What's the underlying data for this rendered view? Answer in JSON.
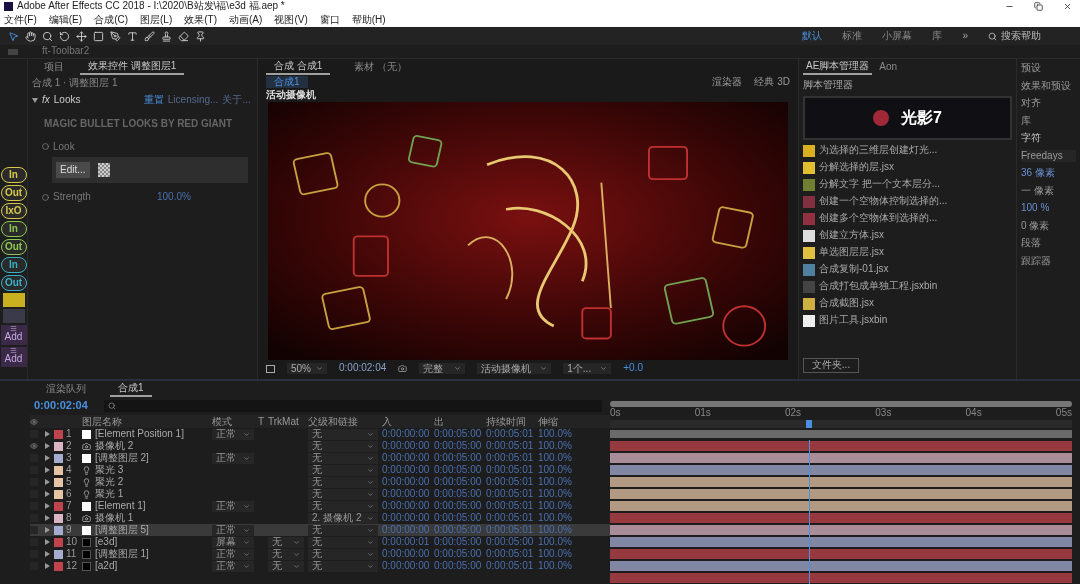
{
  "window": {
    "title": "Adobe After Effects CC 2018 - I:\\2020\\B站发\\福\\e3d 福.aep *"
  },
  "menu": [
    "文件(F)",
    "编辑(E)",
    "合成(C)",
    "图层(L)",
    "效果(T)",
    "动画(A)",
    "视图(V)",
    "窗口",
    "帮助(H)"
  ],
  "workspaces": [
    {
      "label": "默认",
      "selected": true
    },
    {
      "label": "标准",
      "selected": false
    },
    {
      "label": "小屏幕",
      "selected": false
    },
    {
      "label": "库",
      "selected": false
    }
  ],
  "workspace_more": "»",
  "search_help": {
    "placeholder": "搜索帮助"
  },
  "toolbar_panel": {
    "title": "ft-Toolbar2"
  },
  "script_buttons": [
    {
      "label": "In",
      "color": "#d8c84a"
    },
    {
      "label": "Out",
      "color": "#d8c84a"
    },
    {
      "label": "IxO",
      "color": "#d8c84a"
    },
    {
      "label": "In",
      "color": "#8cc850"
    },
    {
      "label": "Out",
      "color": "#8cc850"
    },
    {
      "label": "In",
      "color": "#3ab0c8"
    },
    {
      "label": "Out",
      "color": "#3ab0c8"
    }
  ],
  "add_buttons": [
    "Add",
    "Add"
  ],
  "effect_panel": {
    "tabs": [
      {
        "label": "项目",
        "selected": false
      },
      {
        "label": "效果控件 调整图层1",
        "selected": true
      }
    ],
    "subtitle": "合成 1 · 调整图层 1",
    "effect": {
      "badge": "fx",
      "name": "Looks",
      "expanded": true,
      "links": [
        "重置",
        "Licensing...",
        "关于..."
      ]
    },
    "banner": "MAGIC BULLET LOOKS BY RED GIANT",
    "look": {
      "label": "Look",
      "button": "Edit..."
    },
    "strength": {
      "label": "Strength",
      "value": "100.0%"
    }
  },
  "comp_panel": {
    "tabs": [
      {
        "label": "合成 合成1",
        "selected": true
      },
      {
        "label": "素材 （无）",
        "selected": false
      }
    ],
    "subtab": "合成1",
    "camera_label": "活动摄像机",
    "renderer_label": "渲染器",
    "renderer": "经典 3D",
    "viewer": {
      "zoom": "50%",
      "timecode": "0:00:02:04",
      "resolution": "完整",
      "view": "活动摄像机",
      "views": "1个...",
      "exposure": "+0.0"
    }
  },
  "script_panel": {
    "tabs": [
      {
        "label": "AE脚本管理器",
        "selected": true
      },
      {
        "label": "Aon",
        "selected": false
      }
    ],
    "title": "脚本管理器",
    "banner": "光影7",
    "scripts": [
      "为选择的三维层创建灯光...",
      "分解选择的层.jsx",
      "分解文字 把一个文本层分...",
      "创建一个空物体控制选择的...",
      "创建多个空物体到选择的...",
      "创建立方体.jsx",
      "单选图层层.jsx",
      "合成复制-01.jsx",
      "合成打包成单独工程.jsxbin",
      "合成截图.jsx",
      "图片工具.jsxbin"
    ],
    "folder_button": "文件夹..."
  },
  "side_panel": {
    "items": [
      "预设",
      "效果和预设",
      "对齐",
      "库"
    ],
    "character": {
      "title": "字符",
      "font": "Freedays",
      "size": "36 像素",
      "leading": "一 像素",
      "tracking": "100 %",
      "baseline": "0 像素"
    },
    "more": [
      "段落",
      "跟踪器"
    ]
  },
  "timeline": {
    "tabs": [
      {
        "label": "渲染队列",
        "selected": false
      },
      {
        "label": "合成1",
        "selected": true
      }
    ],
    "timecode": "0:00:02:04",
    "columns": [
      "图层名称",
      "模式",
      "T",
      "TrkMat",
      "父级和链接",
      "入",
      "出",
      "持续时间",
      "伸缩"
    ],
    "ruler": [
      "0s",
      "01s",
      "02s",
      "03s",
      "04s",
      "05s"
    ],
    "playhead": {
      "level": 0.43
    },
    "layers": [
      {
        "num": "1",
        "name": "[Element Position 1]",
        "kind": "solid",
        "color": "#c0444c",
        "mode": "正常",
        "parent": "无",
        "in": "0:00:00:00",
        "out": "0:00:05:00",
        "duration": "0:00:05:01",
        "stretch": "100.0%",
        "visible": false,
        "selected": false
      },
      {
        "num": "2",
        "name": "摄像机 2",
        "kind": "camera",
        "color": "#d8b4c4",
        "parent": "无",
        "in": "0:00:00:00",
        "out": "0:00:05:00",
        "duration": "0:00:05:01",
        "stretch": "100.0%",
        "visible": true,
        "selected": false
      },
      {
        "num": "3",
        "name": "[调整图层 2]",
        "kind": "solid",
        "color": "#a4acd0",
        "mode": "正常",
        "parent": "无",
        "in": "0:00:00:00",
        "out": "0:00:05:00",
        "duration": "0:00:05:01",
        "stretch": "100.0%",
        "visible": false,
        "selected": false
      },
      {
        "num": "4",
        "name": "聚光 3",
        "kind": "light",
        "color": "#e4c4a4",
        "parent": "无",
        "in": "0:00:00:00",
        "out": "0:00:05:00",
        "duration": "0:00:05:01",
        "stretch": "100.0%",
        "visible": false,
        "selected": false
      },
      {
        "num": "5",
        "name": "聚光 2",
        "kind": "light",
        "color": "#e4c4a4",
        "parent": "无",
        "in": "0:00:00:00",
        "out": "0:00:05:00",
        "duration": "0:00:05:01",
        "stretch": "100.0%",
        "visible": false,
        "selected": false
      },
      {
        "num": "6",
        "name": "聚光 1",
        "kind": "light",
        "color": "#e4c4a4",
        "parent": "无",
        "in": "0:00:00:00",
        "out": "0:00:05:00",
        "duration": "0:00:05:01",
        "stretch": "100.0%",
        "visible": false,
        "selected": false
      },
      {
        "num": "7",
        "name": "[Element 1]",
        "kind": "solid",
        "color": "#c0444c",
        "mode": "正常",
        "parent": "无",
        "in": "0:00:00:00",
        "out": "0:00:05:00",
        "duration": "0:00:05:01",
        "stretch": "100.0%",
        "visible": false,
        "selected": false
      },
      {
        "num": "8",
        "name": "摄像机 1",
        "kind": "camera",
        "color": "#d8b4c4",
        "parent": "2. 摄像机 2",
        "in": "0:00:00:00",
        "out": "0:00:05:00",
        "duration": "0:00:05:01",
        "stretch": "100.0%",
        "visible": false,
        "selected": false
      },
      {
        "num": "9",
        "name": "[调整图层 5]",
        "kind": "solid",
        "color": "#a4acd0",
        "mode": "正常",
        "parent": "无",
        "in": "0:00:00:00",
        "out": "0:00:05:00",
        "duration": "0:00:05:01",
        "stretch": "100.0%",
        "visible": false,
        "selected": true
      },
      {
        "num": "10",
        "name": "[e3d]",
        "kind": "black",
        "color": "#c0444c",
        "mode": "屏幕",
        "trkmat": "无",
        "parent": "无",
        "in": "0:00:00:01",
        "out": "0:00:05:00",
        "duration": "0:00:05:00",
        "stretch": "100.0%",
        "visible": false,
        "selected": false
      },
      {
        "num": "11",
        "name": "[调整图层 1]",
        "kind": "black",
        "color": "#a4acd0",
        "mode": "正常",
        "trkmat": "无",
        "parent": "无",
        "in": "0:00:00:00",
        "out": "0:00:05:00",
        "duration": "0:00:05:01",
        "stretch": "100.0%",
        "visible": false,
        "selected": false
      },
      {
        "num": "12",
        "name": "[a2d]",
        "kind": "black",
        "color": "#c0444c",
        "mode": "正常",
        "trkmat": "无",
        "parent": "无",
        "in": "0:00:00:00",
        "out": "0:00:05:00",
        "duration": "0:00:05:01",
        "stretch": "100.0%",
        "visible": false,
        "selected": false
      }
    ]
  }
}
